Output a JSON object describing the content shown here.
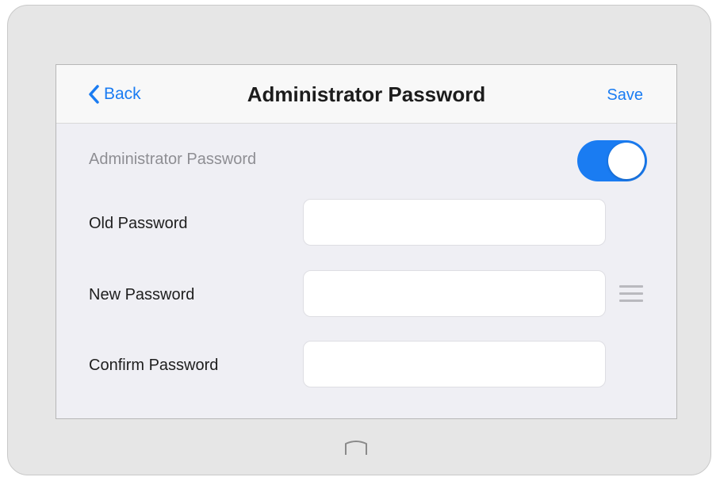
{
  "navbar": {
    "back_label": "Back",
    "title": "Administrator Password",
    "save_label": "Save"
  },
  "admin_password_toggle": {
    "label": "Administrator Password",
    "state": "on"
  },
  "form": {
    "old_password": {
      "label": "Old Password",
      "value": "",
      "placeholder": ""
    },
    "new_password": {
      "label": "New Password",
      "value": "",
      "placeholder": ""
    },
    "confirm_password": {
      "label": "Confirm Password",
      "value": "",
      "placeholder": ""
    }
  },
  "icons": {
    "back": "chevron-left-icon",
    "drag": "drag-handle-icon",
    "home": "home-button-icon"
  },
  "colors": {
    "accent": "#1a7cf2",
    "background": "#efeff4",
    "device_frame": "#e6e6e6"
  }
}
